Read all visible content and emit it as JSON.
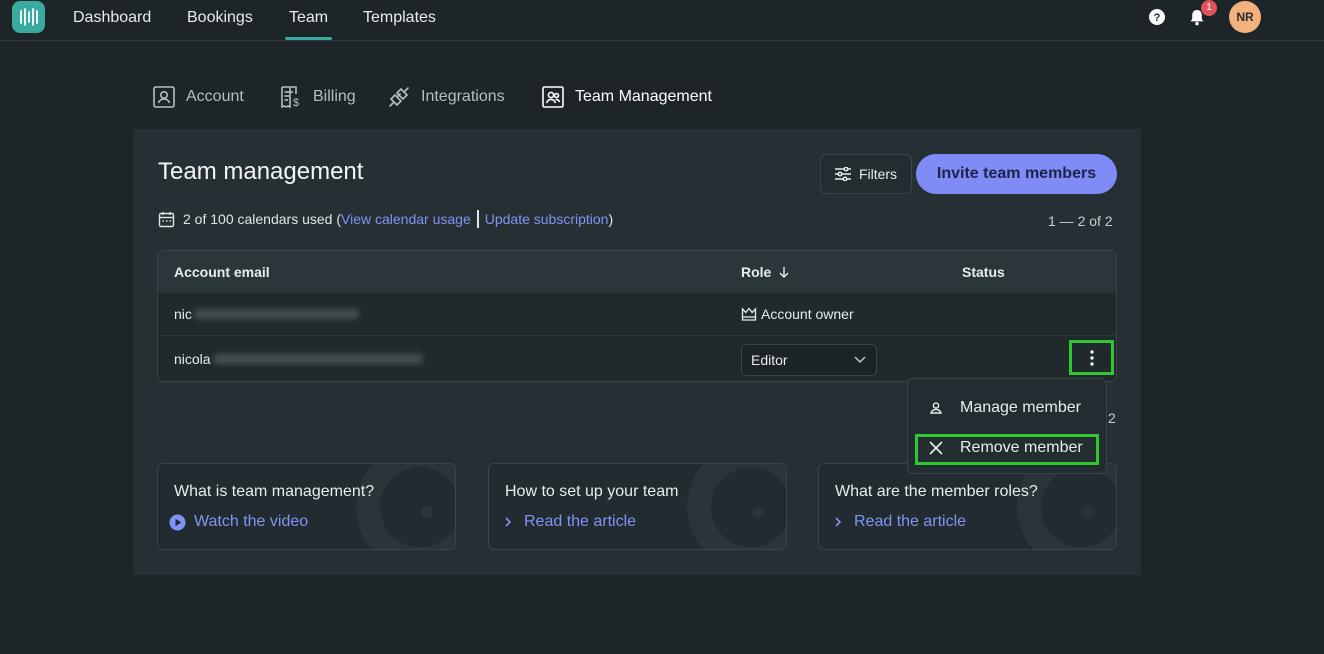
{
  "app": {
    "nav": [
      {
        "label": "Dashboard"
      },
      {
        "label": "Bookings"
      },
      {
        "label": "Team"
      },
      {
        "label": "Templates"
      }
    ],
    "notification_count": "1",
    "avatar_initials": "NR"
  },
  "settings_tabs": [
    {
      "label": "Account"
    },
    {
      "label": "Billing"
    },
    {
      "label": "Integrations"
    },
    {
      "label": "Team Management"
    }
  ],
  "page": {
    "title": "Team management",
    "filters_label": "Filters",
    "invite_label": "Invite team members",
    "usage_text": "2 of 100 calendars used",
    "view_usage_link": "View calendar usage",
    "update_subscription_link": "Update subscription",
    "pager_top": "1 — 2 of 2",
    "pager_bottom": "2"
  },
  "table": {
    "headers": {
      "email": "Account email",
      "role": "Role",
      "status": "Status"
    },
    "rows": [
      {
        "email_visible": "nic",
        "role": "Account owner"
      },
      {
        "email_visible": "nicola",
        "role": "Editor"
      }
    ]
  },
  "menu": {
    "items": [
      {
        "label": "Manage member"
      },
      {
        "label": "Remove member"
      }
    ]
  },
  "cards": [
    {
      "title": "What is team management?",
      "link": "Watch the video"
    },
    {
      "title": "How to set up your team",
      "link": "Read the article"
    },
    {
      "title": "What are the member roles?",
      "link": "Read the article"
    }
  ],
  "colors": {
    "background": "#1d2528",
    "panel": "#263034",
    "accent_teal": "#3aa99f",
    "primary_button": "#7f8cf5",
    "link": "#7f95f5",
    "highlight_box": "#2fc92f",
    "badge": "#e0535a"
  }
}
